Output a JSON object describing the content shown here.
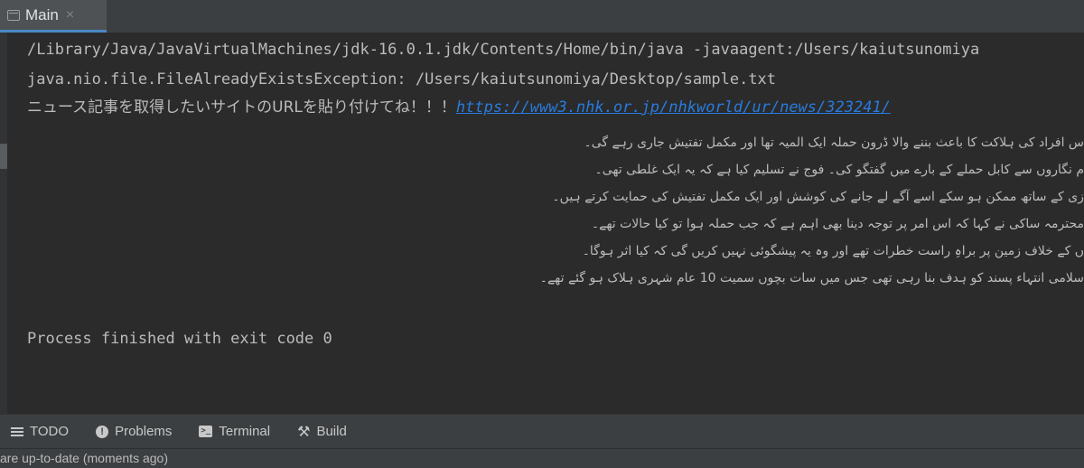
{
  "tab": {
    "label": "Main",
    "close": "×"
  },
  "console": {
    "line1": "/Library/Java/JavaVirtualMachines/jdk-16.0.1.jdk/Contents/Home/bin/java -javaagent:/Users/kaiutsunomiya",
    "line2": "java.nio.file.FileAlreadyExistsException: /Users/kaiutsunomiya/Desktop/sample.txt",
    "line3_prompt": "ニュース記事を取得したいサイトのURLを貼り付けてね！！！",
    "line3_link": "https://www3.nhk.or.jp/nhkworld/ur/news/323241/",
    "urdu_lines": [
      "س افراد کی ہلاکت کا باعث بننے والا ڈرون حملہ ایک المیہ تھا اور مکمل تفتیش جاری رہے گی۔",
      "م نگاروں سے کابل حملے کے بارے میں گفتگو کی۔ فوج نے تسلیم کیا ہے کہ یہ ایک غلطی تھی۔",
      "زی کے ساتھ ممکن ہو سکے اسے آگے لے جانے کی کوشش اور ایک مکمل تفتیش کی حمایت کرتے ہیں۔",
      "محترمہ ساکی نے کہا کہ اس امر پر توجہ دینا بھی اہم ہے کہ جب حملہ ہوا تو کیا حالات تھے۔",
      "ں کے خلاف زمین پر براہِ راست خطرات تھے اور وہ یہ پیشگوئی نہیں کریں گی کہ کیا اثر ہوگا۔",
      "سلامی انتہاء پسند کو ہدف بنا رہی تھی جس میں سات بچوں سمیت 10 عام شہری ہلاک ہو گئے تھے۔"
    ],
    "exit_message": "Process finished with exit code 0"
  },
  "tool_windows": [
    {
      "label": "TODO",
      "icon": "list-icon"
    },
    {
      "label": "Problems",
      "icon": "problems-icon"
    },
    {
      "label": "Terminal",
      "icon": "terminal-icon"
    },
    {
      "label": "Build",
      "icon": "hammer-icon"
    }
  ],
  "status_bar": {
    "text": "are up-to-date (moments ago)"
  },
  "colors": {
    "link": "#287bde",
    "accent": "#4a88c7",
    "background": "#2b2b2b"
  }
}
